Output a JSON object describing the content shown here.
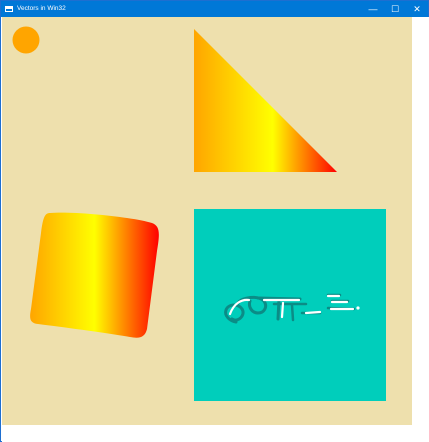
{
  "window": {
    "title": "Vectors in Win32",
    "controls": {
      "minimize_glyph": "—",
      "maximize_glyph": "☐",
      "close_glyph": "✕"
    }
  },
  "canvas": {
    "background_color": "#EEE0AD",
    "circle_color": "#FFA500",
    "gradient_colors": [
      "#FFA500",
      "#FFFF00",
      "#FF0000"
    ],
    "square_color": "#00CEBB",
    "lottie_stroke_color": "#0B8C86",
    "lottie_logo_text": "Lottie"
  }
}
